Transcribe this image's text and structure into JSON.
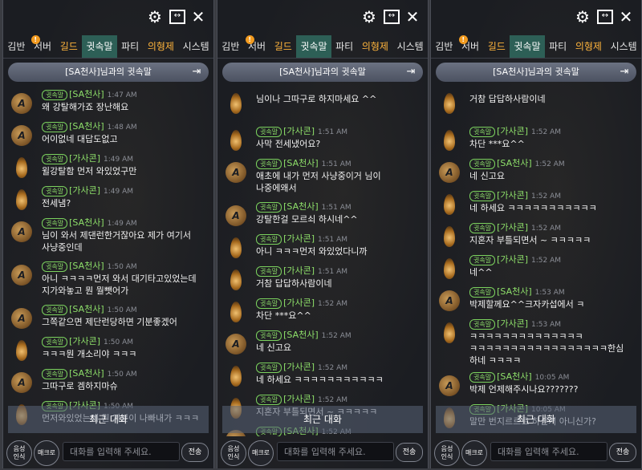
{
  "tabs": [
    {
      "label": "김반",
      "style": "normal"
    },
    {
      "label": "서버",
      "style": "normal",
      "notif": "!"
    },
    {
      "label": "길드",
      "style": "orange"
    },
    {
      "label": "귓속말",
      "style": "active"
    },
    {
      "label": "파티",
      "style": "normal"
    },
    {
      "label": "의형제",
      "style": "orange"
    },
    {
      "label": "시스템",
      "style": "normal"
    }
  ],
  "header_title": "[SA천사]님과의 귓속말",
  "badge_label": "귓속말",
  "recent_label": "최근 대화",
  "voice_label": "음성\n인식",
  "macro_label": "매크로",
  "input_placeholder": "대화를 입력해 주세요.",
  "send_label": "전송",
  "panels": [
    {
      "messages": [
        {
          "name": "[SA천사]",
          "time": "1:47 AM",
          "avatar": "round",
          "lines": [
            "왜 강탈해가죠 장난해요"
          ]
        },
        {
          "name": "[SA천사]",
          "time": "1:48 AM",
          "avatar": "round",
          "lines": [
            "어이없네 대답도없고"
          ]
        },
        {
          "name": "[가사콘]",
          "time": "1:49 AM",
          "avatar": "flame",
          "lines": [
            "윌강탈함 먼저 와있었구만"
          ]
        },
        {
          "name": "[가사콘]",
          "time": "1:49 AM",
          "avatar": "flame",
          "lines": [
            "전세냄?"
          ]
        },
        {
          "name": "[SA천사]",
          "time": "1:49 AM",
          "avatar": "round",
          "lines": [
            "님이 와서 제댄런한거잖아요 제가 여기서",
            "사냥중인데"
          ]
        },
        {
          "name": "[SA천사]",
          "time": "1:50 AM",
          "avatar": "round",
          "lines": [
            "아니 ㅋㅋㅋㅋ먼저 와서 대기타고있었는데",
            "지가와놓고 뭔 뭘뺏어가"
          ]
        },
        {
          "name": "[SA천사]",
          "time": "1:50 AM",
          "avatar": "round",
          "lines": [
            "그쪽같으면 제단런당하면 기분좋겠어"
          ]
        },
        {
          "name": "[가사콘]",
          "time": "1:50 AM",
          "avatar": "flame",
          "lines": [
            "ㅋㅋㅋ뭔 개소리야 ㅋㅋㅋ"
          ]
        },
        {
          "name": "[SA천사]",
          "time": "1:50 AM",
          "avatar": "round",
          "lines": [
            "그따구로 겜하지마슈"
          ]
        },
        {
          "name": "[가사콘]",
          "time": "1:50 AM",
          "avatar": "flame",
          "lines": [
            "먼저와있었는데 뭔 기분이 나빠내가 ㅋㅋㅋ"
          ]
        }
      ]
    },
    {
      "messages": [
        {
          "name": "",
          "time": "",
          "avatar": "flame",
          "lines": [
            "님이나 그따구로 하지마세요 ^^"
          ]
        },
        {
          "name": "[가사콘]",
          "time": "1:51 AM",
          "avatar": "flame",
          "lines": [
            "사막 전세냈어요?"
          ]
        },
        {
          "name": "[SA천사]",
          "time": "1:51 AM",
          "avatar": "round",
          "lines": [
            "애초에 내가 먼저 사냥중이거 님이",
            "나중에왜서"
          ]
        },
        {
          "name": "[SA천사]",
          "time": "1:51 AM",
          "avatar": "round",
          "lines": [
            "강탈한걸 모르쇠 하시네^^"
          ]
        },
        {
          "name": "[가사콘]",
          "time": "1:51 AM",
          "avatar": "flame",
          "lines": [
            "아니 ㅋㅋㅋ먼저 와있었다니까"
          ]
        },
        {
          "name": "[가사콘]",
          "time": "1:51 AM",
          "avatar": "flame",
          "lines": [
            "거참 답답하사람이네"
          ]
        },
        {
          "name": "[가사콘]",
          "time": "1:52 AM",
          "avatar": "flame",
          "lines": [
            "차단 ***요^^"
          ]
        },
        {
          "name": "[SA천사]",
          "time": "1:52 AM",
          "avatar": "round",
          "lines": [
            "네 신고요"
          ]
        },
        {
          "name": "[가사콘]",
          "time": "1:52 AM",
          "avatar": "flame",
          "lines": [
            "네 하세요 ㅋㅋㅋㅋㅋㅋㅋㅋㅋㅋㅋ"
          ]
        },
        {
          "name": "[가사콘]",
          "time": "1:52 AM",
          "avatar": "flame",
          "lines": [
            "지혼자 부틀되면서 ~ ㅋㅋㅋㅋㅋ"
          ]
        },
        {
          "name": "[SA천사]",
          "time": "1:52 AM",
          "avatar": "round",
          "lines": [
            ""
          ]
        }
      ]
    },
    {
      "messages": [
        {
          "name": "",
          "time": "",
          "avatar": "flame",
          "lines": [
            "거참 답답하사람이네"
          ]
        },
        {
          "name": "[가사콘]",
          "time": "1:52 AM",
          "avatar": "flame",
          "lines": [
            "차단 ***요^^"
          ]
        },
        {
          "name": "[SA천사]",
          "time": "1:52 AM",
          "avatar": "round",
          "lines": [
            "네 신고요"
          ]
        },
        {
          "name": "[가사콘]",
          "time": "1:52 AM",
          "avatar": "flame",
          "lines": [
            "네 하세요 ㅋㅋㅋㅋㅋㅋㅋㅋㅋㅋㅋ"
          ]
        },
        {
          "name": "[가사콘]",
          "time": "1:52 AM",
          "avatar": "flame",
          "lines": [
            "지혼자 부틀되면서 ~ ㅋㅋㅋㅋㅋ"
          ]
        },
        {
          "name": "[가사콘]",
          "time": "1:52 AM",
          "avatar": "flame",
          "lines": [
            "네^^"
          ]
        },
        {
          "name": "[SA천사]",
          "time": "1:53 AM",
          "avatar": "round",
          "lines": [
            "박제할께요^^크자카섭에서 ㅋ"
          ]
        },
        {
          "name": "[가사콘]",
          "time": "1:53 AM",
          "avatar": "flame",
          "lines": [
            "ㅋㅋㅋㅋㅋㅋㅋㅋㅋㅋㅋㅋㅋㅋ",
            "ㅋㅋㅋㅋㅋㅋㅋㅋㅋㅋㅋㅋㅋㅋㅋㅋㅋ한심",
            "하네 ㅋㅋㅋㅋ"
          ]
        },
        {
          "name": "[SA천사]",
          "time": "10:05 AM",
          "avatar": "round",
          "lines": [
            "박제 언제해주시나요???????"
          ]
        },
        {
          "name": "[가사콘]",
          "time": "10:05 AM",
          "avatar": "flame",
          "lines": [
            "말만 번지르르르 하신거 아니신가?"
          ]
        }
      ]
    }
  ]
}
